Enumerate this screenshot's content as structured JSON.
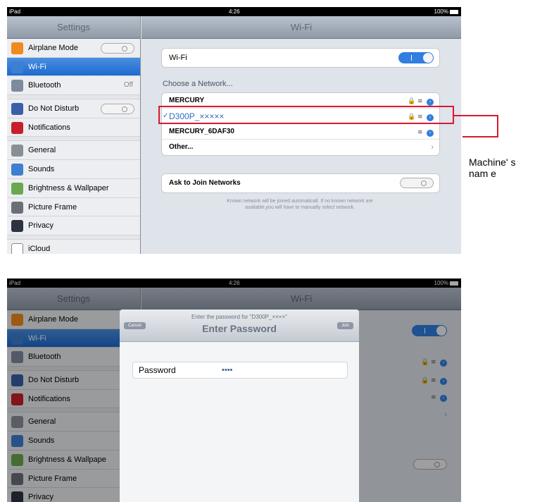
{
  "status": {
    "left": "iPad",
    "time": "4:26",
    "battery": "100%"
  },
  "sidebar": {
    "title": "Settings",
    "items": [
      {
        "label": "Airplane Mode",
        "value": ""
      },
      {
        "label": "Wi-Fi",
        "value": ""
      },
      {
        "label": "Bluetooth",
        "value": "Off"
      },
      {
        "label": "Do Not Disturb",
        "value": ""
      },
      {
        "label": "Notifications",
        "value": ""
      },
      {
        "label": "General",
        "value": ""
      },
      {
        "label": "Sounds",
        "value": ""
      },
      {
        "label": "Brightness & Wallpaper",
        "value": ""
      },
      {
        "label": "Picture Frame",
        "value": ""
      },
      {
        "label": "Privacy",
        "value": ""
      },
      {
        "label": "iCloud",
        "value": ""
      }
    ],
    "items_dialog": [
      {
        "label": "Airplane Mode"
      },
      {
        "label": "Wi-Fi"
      },
      {
        "label": "Bluetooth"
      },
      {
        "label": "Do Not Disturb"
      },
      {
        "label": "Notifications"
      },
      {
        "label": "General"
      },
      {
        "label": "Sounds"
      },
      {
        "label": "Brightness & Wallpape"
      },
      {
        "label": "Picture Frame"
      },
      {
        "label": "Privacy"
      }
    ]
  },
  "wifi": {
    "title": "Wi-Fi",
    "toggle_label": "Wi-Fi",
    "choose_label": "Choose a Network...",
    "networks": [
      {
        "name": "MERCURY"
      },
      {
        "name": "D300P_×××××",
        "selected": true
      },
      {
        "name": "MERCURY_6DAF30"
      },
      {
        "name": "Other..."
      }
    ],
    "ask_label": "Ask to Join Networks",
    "note": "Known network will be joined automaticall. If no known network are available,you will have to manually select network."
  },
  "callout": {
    "text": "Machine' s nam e"
  },
  "dialog": {
    "prompt": "Enter the password for \"D300P_××××\"",
    "title": "Enter Password",
    "cancel": "Cancel",
    "join": "Join",
    "password_label": "Password",
    "password_value": "••••"
  },
  "colors": {
    "accent": "#2f7ee0",
    "callout": "#d8192e"
  }
}
